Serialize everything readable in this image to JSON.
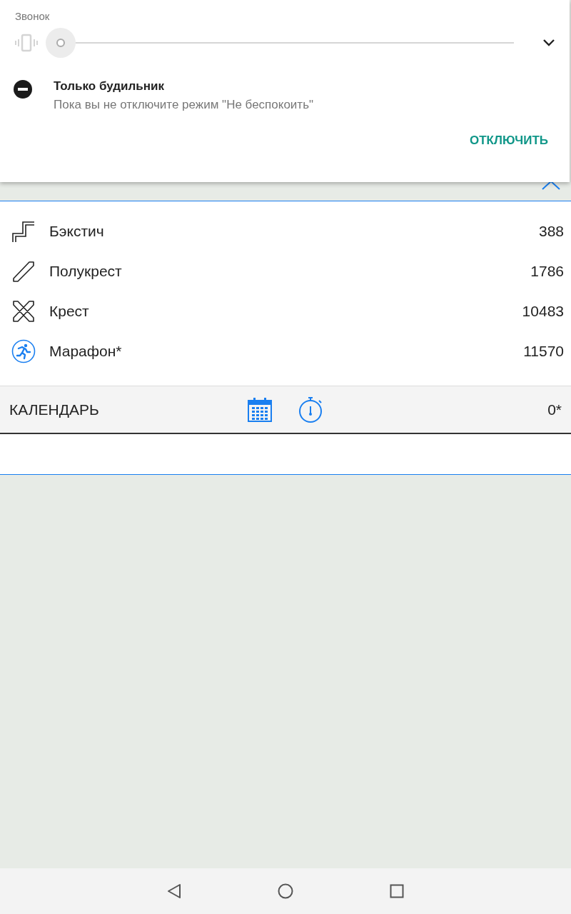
{
  "volume_panel": {
    "stream_label": "Звонок",
    "ringer": {
      "level": 0
    },
    "dnd": {
      "title": "Только будильник",
      "subtitle": "Пока вы не отключите режим \"Не беспокоить\"",
      "action": "ОТКЛЮЧИТЬ"
    }
  },
  "stats": [
    {
      "kind": "backstitch",
      "label": "Бэкстич",
      "value": "388"
    },
    {
      "kind": "half",
      "label": "Полукрест",
      "value": "1786"
    },
    {
      "kind": "cross",
      "label": "Крест",
      "value": "10483"
    },
    {
      "kind": "marathon",
      "label": "Марафон*",
      "value": "11570"
    }
  ],
  "calendar_bar": {
    "title": "КАЛЕНДАРЬ",
    "value": "0*"
  }
}
